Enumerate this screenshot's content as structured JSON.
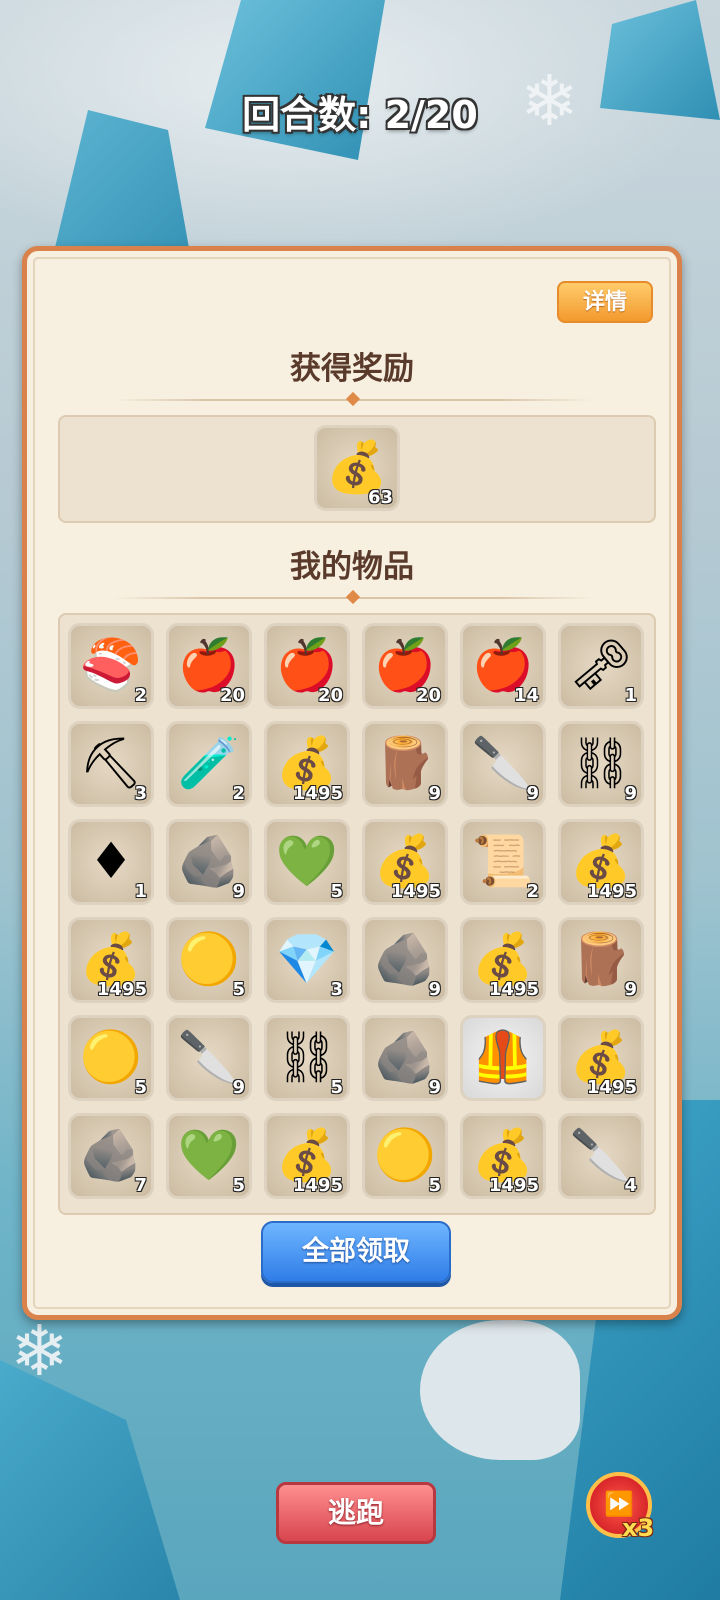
{
  "round": {
    "label": "回合数: 2/20"
  },
  "panel": {
    "details_label": "详情",
    "reward_title": "获得奖励",
    "items_title": "我的物品",
    "claim_all_label": "全部领取"
  },
  "rewards": [
    {
      "icon": "money-bag-icon",
      "glyph": "💰",
      "count": "63"
    }
  ],
  "items": [
    {
      "icon": "salmon-steak-icon",
      "glyph": "🍣",
      "count": "2"
    },
    {
      "icon": "food-bundle-icon",
      "glyph": "🍎",
      "count": "20"
    },
    {
      "icon": "food-bundle-icon",
      "glyph": "🍎",
      "count": "20"
    },
    {
      "icon": "food-bundle-icon",
      "glyph": "🍎",
      "count": "20"
    },
    {
      "icon": "food-bundle-icon",
      "glyph": "🍎",
      "count": "14"
    },
    {
      "icon": "key-icon",
      "glyph": "🗝",
      "count": "1"
    },
    {
      "icon": "shovel-icon",
      "glyph": "⛏",
      "count": "3"
    },
    {
      "icon": "potion-icon",
      "glyph": "🧪",
      "count": "2"
    },
    {
      "icon": "money-bag-icon",
      "glyph": "💰",
      "count": "1495"
    },
    {
      "icon": "wood-logs-icon",
      "glyph": "🪵",
      "count": "9"
    },
    {
      "icon": "leather-knife-icon",
      "glyph": "🔪",
      "count": "9"
    },
    {
      "icon": "iron-ingot-icon",
      "glyph": "⛓",
      "count": "9"
    },
    {
      "icon": "red-gem-icon",
      "glyph": "♦",
      "count": "1"
    },
    {
      "icon": "stone-pile-icon",
      "glyph": "🪨",
      "count": "9"
    },
    {
      "icon": "green-crystal-icon",
      "glyph": "💚",
      "count": "5"
    },
    {
      "icon": "money-bag-icon",
      "glyph": "💰",
      "count": "1495"
    },
    {
      "icon": "scroll-icon",
      "glyph": "📜",
      "count": "2"
    },
    {
      "icon": "money-bag-icon",
      "glyph": "💰",
      "count": "1495"
    },
    {
      "icon": "money-bag-icon",
      "glyph": "💰",
      "count": "1495"
    },
    {
      "icon": "gold-ore-icon",
      "glyph": "🟡",
      "count": "5"
    },
    {
      "icon": "purple-gem-icon",
      "glyph": "💎",
      "count": "3"
    },
    {
      "icon": "stone-pile-icon",
      "glyph": "🪨",
      "count": "9"
    },
    {
      "icon": "money-bag-icon",
      "glyph": "💰",
      "count": "1495"
    },
    {
      "icon": "wood-logs-icon",
      "glyph": "🪵",
      "count": "9"
    },
    {
      "icon": "gold-ore-icon",
      "glyph": "🟡",
      "count": "5"
    },
    {
      "icon": "leather-knife-icon",
      "glyph": "🔪",
      "count": "9"
    },
    {
      "icon": "iron-ingot-icon",
      "glyph": "⛓",
      "count": "5"
    },
    {
      "icon": "stone-pile-icon",
      "glyph": "🪨",
      "count": "9"
    },
    {
      "icon": "armor-vest-icon",
      "glyph": "🦺",
      "count": "",
      "light": true
    },
    {
      "icon": "money-bag-icon",
      "glyph": "💰",
      "count": "1495"
    },
    {
      "icon": "stone-pile-icon",
      "glyph": "🪨",
      "count": "7"
    },
    {
      "icon": "green-crystal-icon",
      "glyph": "💚",
      "count": "5"
    },
    {
      "icon": "money-bag-icon",
      "glyph": "💰",
      "count": "1495"
    },
    {
      "icon": "gold-ore-icon",
      "glyph": "🟡",
      "count": "5"
    },
    {
      "icon": "money-bag-icon",
      "glyph": "💰",
      "count": "1495"
    },
    {
      "icon": "leather-knife-icon",
      "glyph": "🔪",
      "count": "4"
    }
  ],
  "footer": {
    "escape_label": "逃跑",
    "speed_multiplier": "x3"
  }
}
